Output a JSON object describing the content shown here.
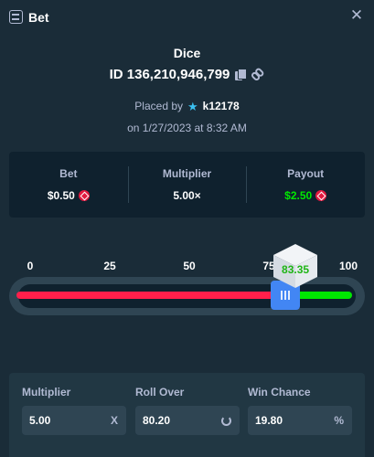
{
  "window": {
    "title": "Bet"
  },
  "bet": {
    "game": "Dice",
    "id": "ID 136,210,946,799",
    "placed_by_prefix": "Placed by",
    "username": "k12178",
    "date": "on 1/27/2023 at 8:32 AM"
  },
  "stats": [
    {
      "label": "Bet",
      "value": "$0.50",
      "has_coin": true,
      "color": "#ffffff"
    },
    {
      "label": "Multiplier",
      "value": "5.00×",
      "has_coin": false,
      "color": "#ffffff"
    },
    {
      "label": "Payout",
      "value": "$2.50",
      "has_coin": true,
      "color": "#00e701"
    }
  ],
  "slider": {
    "ticks": [
      "0",
      "25",
      "50",
      "75",
      "100"
    ],
    "threshold": 80.2,
    "result_label": "83.35",
    "result_value": 83.35,
    "lose_color": "#ff1f4b",
    "win_color": "#00e701"
  },
  "inputs": {
    "multiplier": {
      "label": "Multiplier",
      "value": "5.00",
      "suffix": "X"
    },
    "roll_over": {
      "label": "Roll Over",
      "value": "80.20",
      "suffix_icon": "refresh-icon"
    },
    "win_chance": {
      "label": "Win Chance",
      "value": "19.80",
      "suffix": "%"
    }
  },
  "colors": {
    "background": "#1a2c38",
    "panel": "#0f212e",
    "accent": "#4286f4"
  }
}
